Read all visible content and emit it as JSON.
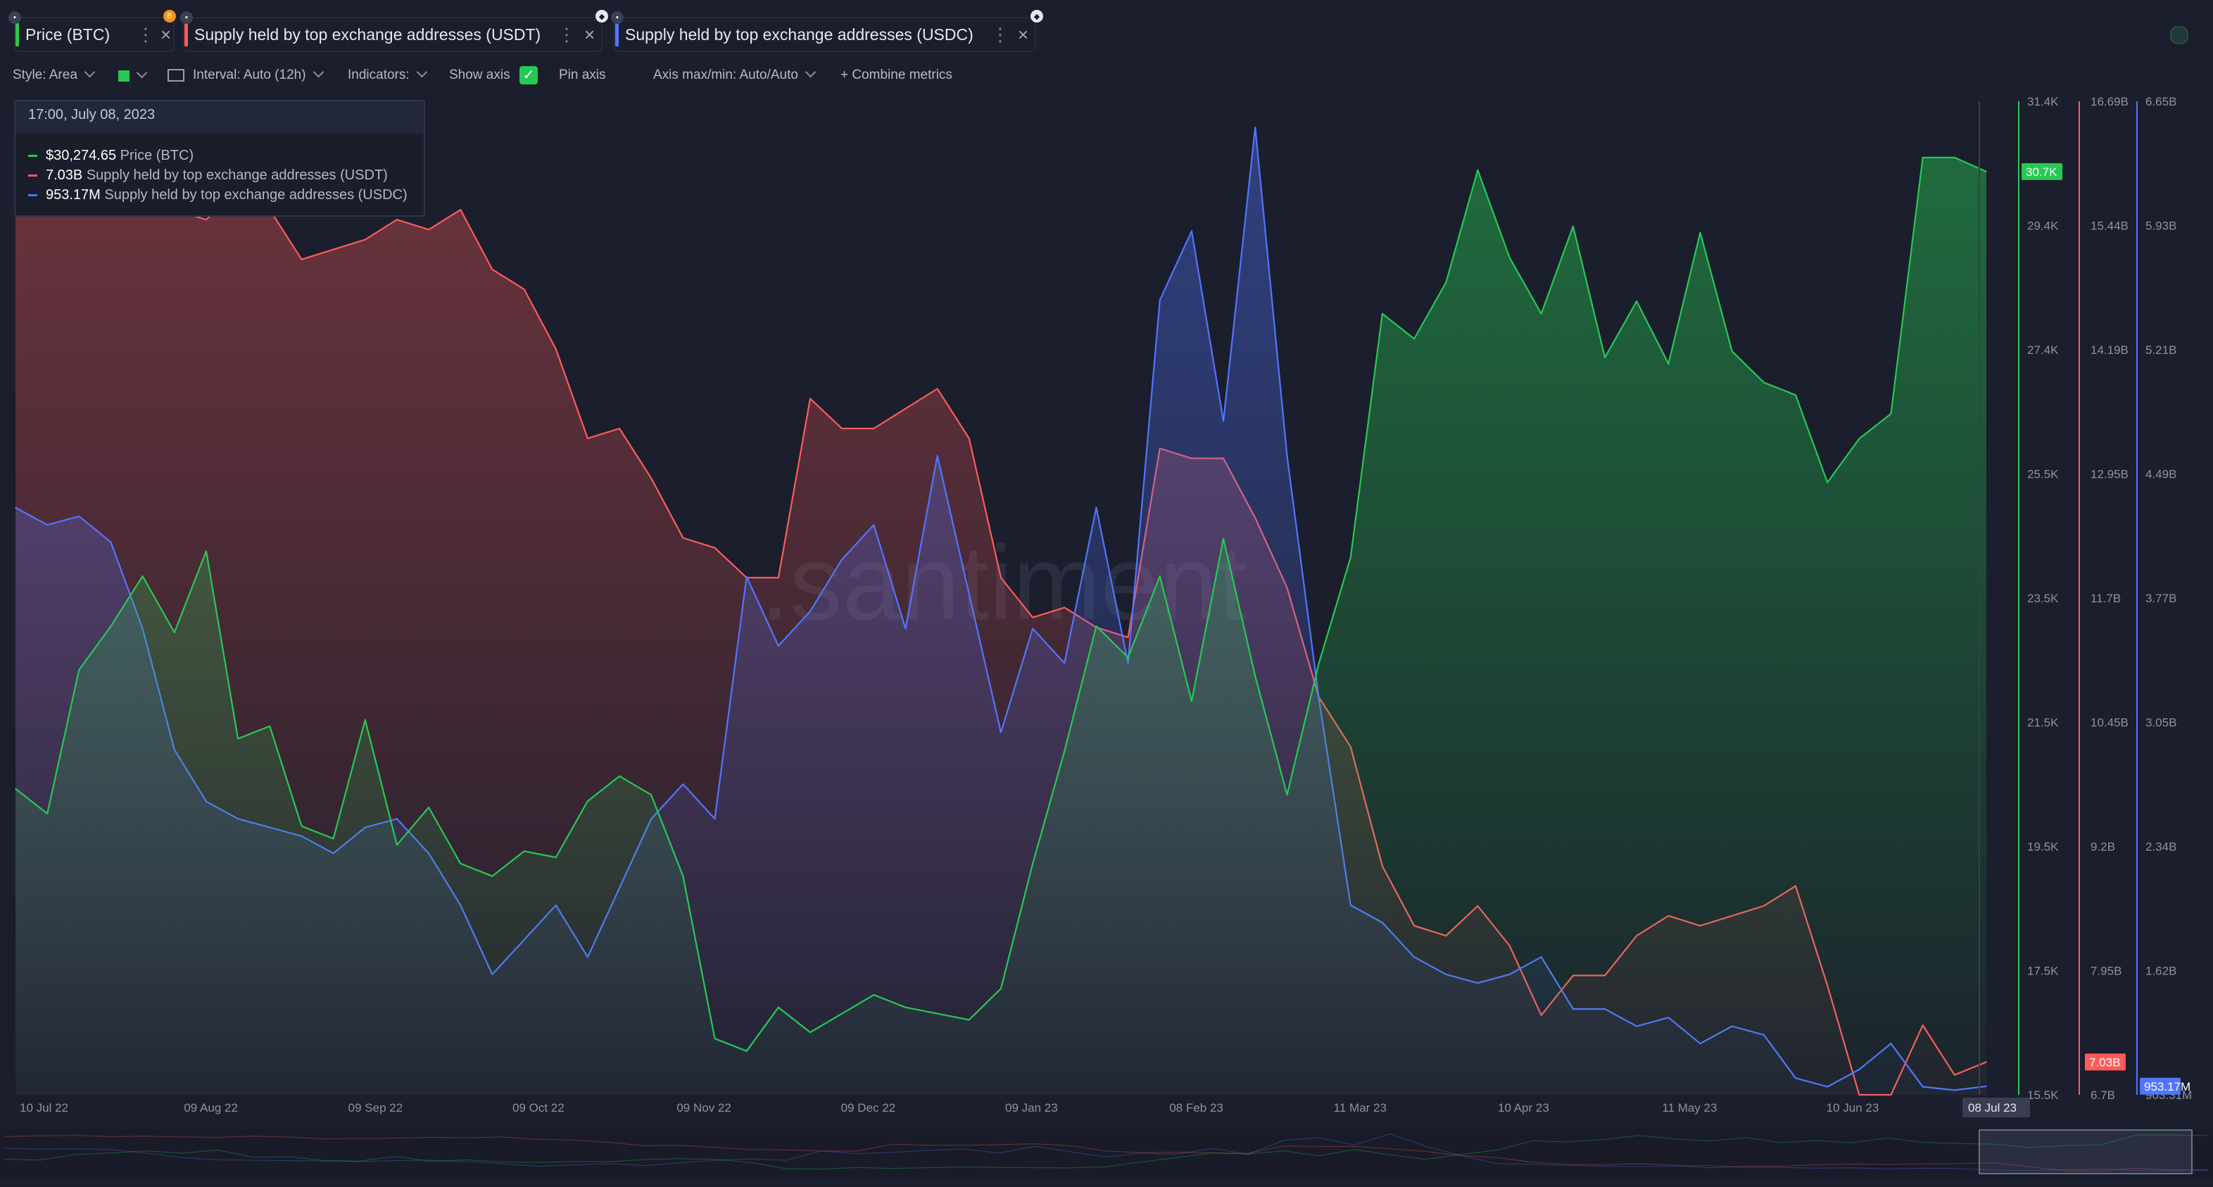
{
  "tabs": [
    {
      "label": "Price (BTC)",
      "color": "#26c953",
      "badge": "B"
    },
    {
      "label": "Supply held by top exchange addresses (USDT)",
      "color": "#ff5b5b",
      "badge": ""
    },
    {
      "label": "Supply held by top exchange addresses (USDC)",
      "color": "#5275ff",
      "badge": ""
    }
  ],
  "toolbar": {
    "style": "Style: Area",
    "interval": "Interval: Auto (12h)",
    "indicators": "Indicators:",
    "show_axis": "Show axis",
    "pin_axis": "Pin axis",
    "axis_minmax": "Axis max/min: Auto/Auto",
    "combine": "+ Combine metrics"
  },
  "tooltip": {
    "date": "17:00, July 08, 2023",
    "rows": [
      {
        "value": "$30,274.65",
        "name": "Price (BTC)",
        "color": "#26c953"
      },
      {
        "value": "7.03B",
        "name": "Supply held by top exchange addresses (USDT)",
        "color": "#ff5b5b"
      },
      {
        "value": "953.17M",
        "name": "Supply held by top exchange addresses (USDC)",
        "color": "#5275ff"
      }
    ]
  },
  "watermark": ".santiment",
  "chart_data": {
    "type": "area",
    "x_labels": [
      "10 Jul 22",
      "09 Aug 22",
      "09 Sep 22",
      "09 Oct 22",
      "09 Nov 22",
      "09 Dec 22",
      "09 Jan 23",
      "08 Feb 23",
      "11 Mar 23",
      "10 Apr 23",
      "11 May 23",
      "10 Jun 23",
      "08 Jul 23"
    ],
    "hover_x_label": "08 Jul 23",
    "axes": [
      {
        "metric": "Price (BTC)",
        "color": "#26c953",
        "ticks": [
          "31.4K",
          "29.4K",
          "27.4K",
          "25.5K",
          "23.5K",
          "21.5K",
          "19.5K",
          "17.5K",
          "15.5K"
        ],
        "range": [
          15500,
          31400
        ],
        "current": "30.7K"
      },
      {
        "metric": "USDT",
        "color": "#ff5b5b",
        "ticks": [
          "16.69B",
          "15.44B",
          "14.19B",
          "12.95B",
          "11.7B",
          "10.45B",
          "9.2B",
          "7.95B",
          "6.7B"
        ],
        "range": [
          6.7,
          16.69
        ],
        "current": "7.03B"
      },
      {
        "metric": "USDC",
        "color": "#5275ff",
        "ticks": [
          "6.65B",
          "5.93B",
          "5.21B",
          "4.49B",
          "3.77B",
          "3.05B",
          "2.34B",
          "1.62B",
          "903.31M"
        ],
        "range": [
          0.90331,
          6.65
        ],
        "current": "953.17M"
      }
    ],
    "series": [
      {
        "name": "Price (BTC)",
        "unit": "USD",
        "color": "#26c953",
        "values": [
          20400,
          20000,
          22300,
          23000,
          23800,
          22900,
          24200,
          21200,
          21400,
          19800,
          19600,
          21500,
          19500,
          20100,
          19200,
          19000,
          19400,
          19300,
          20200,
          20600,
          20300,
          19000,
          16400,
          16200,
          16900,
          16500,
          16800,
          17100,
          16900,
          16800,
          16700,
          17200,
          19200,
          21000,
          23000,
          22500,
          23800,
          21800,
          24400,
          22200,
          20300,
          22400,
          24100,
          28000,
          27600,
          28500,
          30300,
          28900,
          28000,
          29400,
          27300,
          28200,
          27200,
          29300,
          27400,
          26900,
          26700,
          25300,
          26000,
          26400,
          30500,
          30500,
          30274.65
        ]
      },
      {
        "name": "Supply held by top exchange addresses (USDT)",
        "unit": "B",
        "color": "#ff5b5b",
        "values": [
          15.7,
          15.9,
          16.0,
          15.7,
          15.8,
          15.6,
          15.5,
          15.8,
          15.6,
          15.1,
          15.2,
          15.3,
          15.5,
          15.4,
          15.6,
          15.0,
          14.8,
          14.2,
          13.3,
          13.4,
          12.9,
          12.3,
          12.2,
          11.9,
          11.9,
          13.7,
          13.4,
          13.4,
          13.6,
          13.8,
          13.3,
          11.9,
          11.5,
          11.6,
          11.4,
          11.3,
          13.2,
          13.1,
          13.1,
          12.5,
          11.8,
          10.7,
          10.2,
          9.0,
          8.4,
          8.3,
          8.6,
          8.2,
          7.5,
          7.9,
          7.9,
          8.3,
          8.5,
          8.4,
          8.5,
          8.6,
          8.8,
          7.8,
          6.7,
          6.7,
          7.4,
          6.9,
          7.03
        ]
      },
      {
        "name": "Supply held by top exchange addresses (USDC)",
        "unit": "B",
        "color": "#5275ff",
        "values": [
          4.3,
          4.2,
          4.25,
          4.1,
          3.6,
          2.9,
          2.6,
          2.5,
          2.45,
          2.4,
          2.3,
          2.45,
          2.5,
          2.3,
          2.0,
          1.6,
          1.8,
          2.0,
          1.7,
          2.1,
          2.5,
          2.7,
          2.5,
          3.9,
          3.5,
          3.7,
          4.0,
          4.2,
          3.6,
          4.6,
          3.8,
          3.0,
          3.6,
          3.4,
          4.3,
          3.4,
          5.5,
          5.9,
          4.8,
          6.5,
          4.6,
          3.2,
          2.0,
          1.9,
          1.7,
          1.6,
          1.55,
          1.6,
          1.7,
          1.4,
          1.4,
          1.3,
          1.35,
          1.2,
          1.3,
          1.25,
          1.0,
          0.95,
          1.05,
          1.2,
          0.95,
          0.93,
          0.953
        ]
      }
    ],
    "grid": false,
    "legend": "tooltip top-left"
  }
}
